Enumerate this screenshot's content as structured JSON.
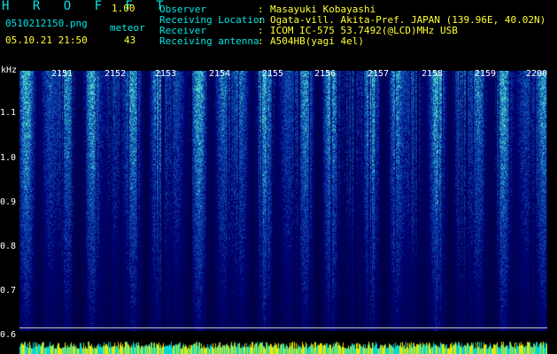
{
  "header": {
    "brand": "H R O F F T",
    "version": "1.00",
    "filename": "0510212150.png",
    "datetime": "05.10.21 21:50",
    "meteor_label": "meteor",
    "meteor_count": "43",
    "fields": [
      {
        "label": "Observer",
        "value": "Masayuki Kobayashi"
      },
      {
        "label": "Receiving Location",
        "value": "Ogata-vill. Akita-Pref. JAPAN (139.96E, 40.02N)"
      },
      {
        "label": "Receiver",
        "value": "ICOM IC-575 53.7492(@LCD)MHz USB"
      },
      {
        "label": "Receiving antenna",
        "value": "A504HB(yagi 4el)"
      }
    ]
  },
  "y_axis": {
    "unit": "kHz",
    "ticks": [
      "1.1",
      "1.0",
      "0.9",
      "0.8",
      "0.7",
      "0.6"
    ]
  },
  "time_axis": {
    "ticks": [
      "2151",
      "2152",
      "2153",
      "2154",
      "2155",
      "2156",
      "2157",
      "2158",
      "2159",
      "2200"
    ]
  },
  "colors": {
    "header_label": "#00e6e6",
    "header_value": "#ffff33",
    "spectrum_low": "#00004a",
    "spectrum_mid": "#1440c8",
    "spectrum_high": "#30e0d0",
    "grid": "#c8c8c8"
  }
}
